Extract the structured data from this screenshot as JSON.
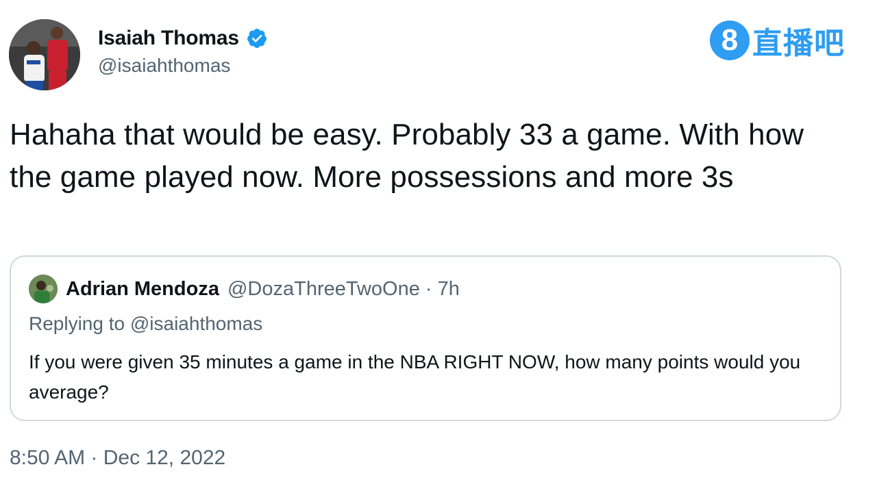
{
  "author": {
    "display_name": "Isaiah Thomas",
    "handle": "@isaiahthomas",
    "verified_icon": "verified-badge-icon"
  },
  "watermark": {
    "number": "8",
    "text": "直播吧",
    "color": "#2e9df2"
  },
  "tweet": {
    "text": "Hahaha that would be easy. Probably 33 a game. With how the game played now. More possessions and more 3s",
    "timestamp": "8:50 AM · Dec 12, 2022"
  },
  "quoted_tweet": {
    "display_name": "Adrian Mendoza",
    "meta": "@DozaThreeTwoOne · 7h",
    "replying_to": "Replying to @isaiahthomas",
    "text": "If you were given 35 minutes a game in the NBA RIGHT NOW, how many points would you average?"
  },
  "colors": {
    "text_primary": "#0f1419",
    "text_secondary": "#536471",
    "border": "#cfd9de",
    "verified": "#1d9bf0"
  }
}
